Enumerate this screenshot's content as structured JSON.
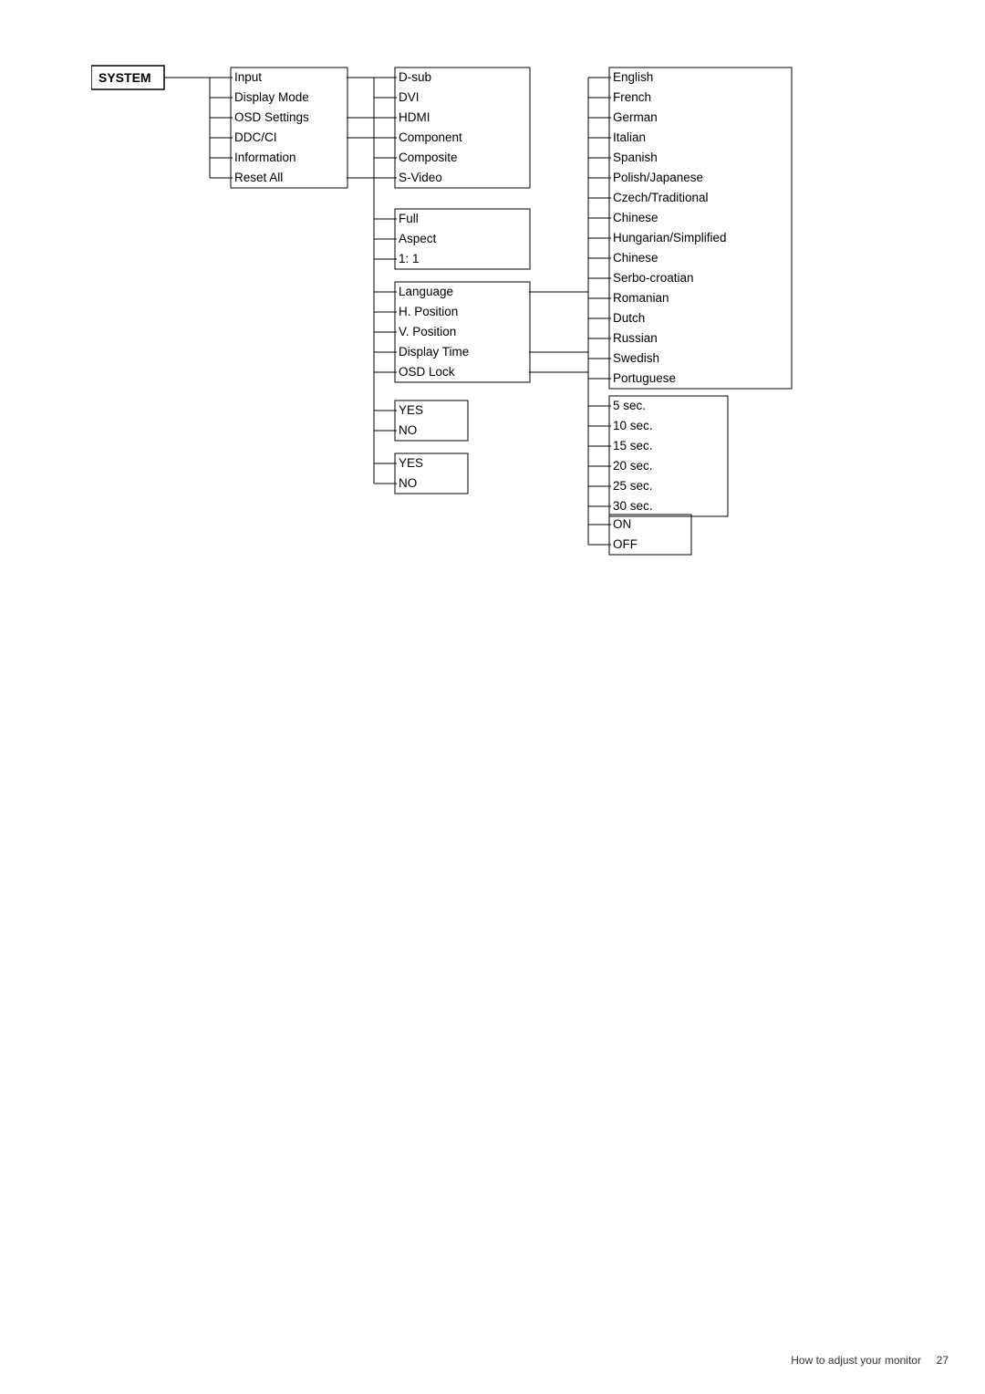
{
  "diagram": {
    "system_label": "SYSTEM",
    "col1_items": [
      {
        "label": "Input",
        "id": "input"
      },
      {
        "label": "Display Mode",
        "id": "display-mode"
      },
      {
        "label": "OSD Settings",
        "id": "osd-settings"
      },
      {
        "label": "DDC/CI",
        "id": "ddc-ci"
      },
      {
        "label": "Information",
        "id": "information"
      },
      {
        "label": "Reset All",
        "id": "reset-all"
      }
    ],
    "col2_items_input": [
      {
        "label": "D-sub",
        "id": "d-sub"
      },
      {
        "label": "DVI",
        "id": "dvi"
      },
      {
        "label": "HDMI",
        "id": "hdmi"
      },
      {
        "label": "Component",
        "id": "component"
      },
      {
        "label": "Composite",
        "id": "composite"
      },
      {
        "label": "S-Video",
        "id": "s-video"
      }
    ],
    "col2_items_osd": [
      {
        "label": "Full",
        "id": "full"
      },
      {
        "label": "Aspect",
        "id": "aspect"
      },
      {
        "label": "1: 1",
        "id": "one-to-one"
      }
    ],
    "col2_items_settings": [
      {
        "label": "Language",
        "id": "language"
      },
      {
        "label": "H. Position",
        "id": "h-position"
      },
      {
        "label": "V. Position",
        "id": "v-position"
      },
      {
        "label": "Display Time",
        "id": "display-time"
      },
      {
        "label": "OSD Lock",
        "id": "osd-lock"
      }
    ],
    "col2_yes_no_1": [
      {
        "label": "YES",
        "id": "yes1"
      },
      {
        "label": "NO",
        "id": "no1"
      }
    ],
    "col2_yes_no_2": [
      {
        "label": "YES",
        "id": "yes2"
      },
      {
        "label": "NO",
        "id": "no2"
      }
    ],
    "col3_languages": [
      {
        "label": "English",
        "id": "english"
      },
      {
        "label": "French",
        "id": "french"
      },
      {
        "label": "German",
        "id": "german"
      },
      {
        "label": "Italian",
        "id": "italian"
      },
      {
        "label": "Spanish",
        "id": "spanish"
      },
      {
        "label": "Polish/Japanese",
        "id": "polish-japanese"
      },
      {
        "label": "Czech/Traditional",
        "id": "czech-traditional"
      },
      {
        "label": "Chinese",
        "id": "chinese1"
      },
      {
        "label": "Hungarian/Simplified",
        "id": "hungarian-simplified"
      },
      {
        "label": "Chinese",
        "id": "chinese2"
      },
      {
        "label": "Serbo-croatian",
        "id": "serbo-croatian"
      },
      {
        "label": "Romanian",
        "id": "romanian"
      },
      {
        "label": "Dutch",
        "id": "dutch"
      },
      {
        "label": "Russian",
        "id": "russian"
      },
      {
        "label": "Swedish",
        "id": "swedish"
      },
      {
        "label": "Portuguese",
        "id": "portuguese"
      }
    ],
    "col3_display_time": [
      {
        "label": "5 sec.",
        "id": "5sec"
      },
      {
        "label": "10 sec.",
        "id": "10sec"
      },
      {
        "label": "15 sec.",
        "id": "15sec"
      },
      {
        "label": "20 sec.",
        "id": "20sec"
      },
      {
        "label": "25 sec.",
        "id": "25sec"
      },
      {
        "label": "30 sec.",
        "id": "30sec"
      }
    ],
    "col3_on_off": [
      {
        "label": "ON",
        "id": "on"
      },
      {
        "label": "OFF",
        "id": "off"
      }
    ]
  },
  "footer": {
    "text": "How to adjust your monitor",
    "page": "27"
  }
}
